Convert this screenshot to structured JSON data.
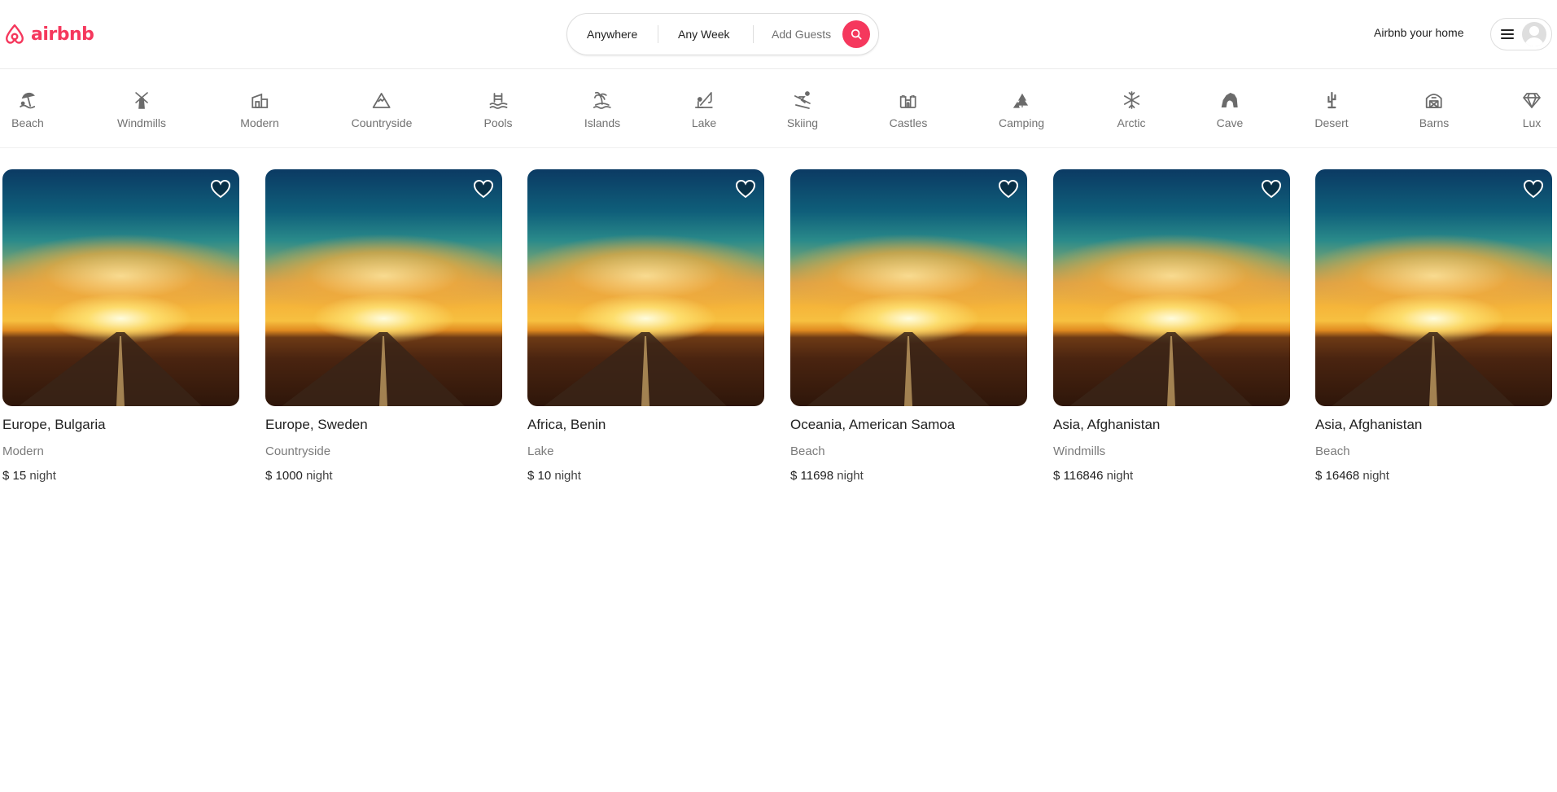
{
  "brand": {
    "name": "airbnb",
    "color": "#f5385d",
    "logo_icon": "airbnb-logo-icon"
  },
  "search": {
    "location": "Anywhere",
    "week": "Any Week",
    "guests": "Add Guests",
    "button_icon": "search-icon"
  },
  "header": {
    "host_link": "Airbnb your home",
    "menu_icon": "hamburger-icon",
    "avatar_icon": "user-avatar-icon"
  },
  "categories": [
    {
      "label": "Beach",
      "icon": "beach-icon"
    },
    {
      "label": "Windmills",
      "icon": "windmill-icon"
    },
    {
      "label": "Modern",
      "icon": "modern-house-icon"
    },
    {
      "label": "Countryside",
      "icon": "mountain-icon"
    },
    {
      "label": "Pools",
      "icon": "pool-icon"
    },
    {
      "label": "Islands",
      "icon": "island-icon"
    },
    {
      "label": "Lake",
      "icon": "fishing-icon"
    },
    {
      "label": "Skiing",
      "icon": "skiing-icon"
    },
    {
      "label": "Castles",
      "icon": "castle-icon"
    },
    {
      "label": "Camping",
      "icon": "tent-icon"
    },
    {
      "label": "Arctic",
      "icon": "snowflake-icon"
    },
    {
      "label": "Cave",
      "icon": "cave-icon"
    },
    {
      "label": "Desert",
      "icon": "cactus-icon"
    },
    {
      "label": "Barns",
      "icon": "barn-icon"
    },
    {
      "label": "Lux",
      "icon": "diamond-icon"
    }
  ],
  "listings": [
    {
      "location": "Europe, Bulgaria",
      "category": "Modern",
      "price": "$ 15",
      "unit": "night"
    },
    {
      "location": "Europe, Sweden",
      "category": "Countryside",
      "price": "$ 1000",
      "unit": "night"
    },
    {
      "location": "Africa, Benin",
      "category": "Lake",
      "price": "$ 10",
      "unit": "night"
    },
    {
      "location": "Oceania, American Samoa",
      "category": "Beach",
      "price": "$ 11698",
      "unit": "night"
    },
    {
      "location": "Asia, Afghanistan",
      "category": "Windmills",
      "price": "$ 116846",
      "unit": "night"
    },
    {
      "location": "Asia, Afghanistan",
      "category": "Beach",
      "price": "$ 16468",
      "unit": "night"
    }
  ]
}
